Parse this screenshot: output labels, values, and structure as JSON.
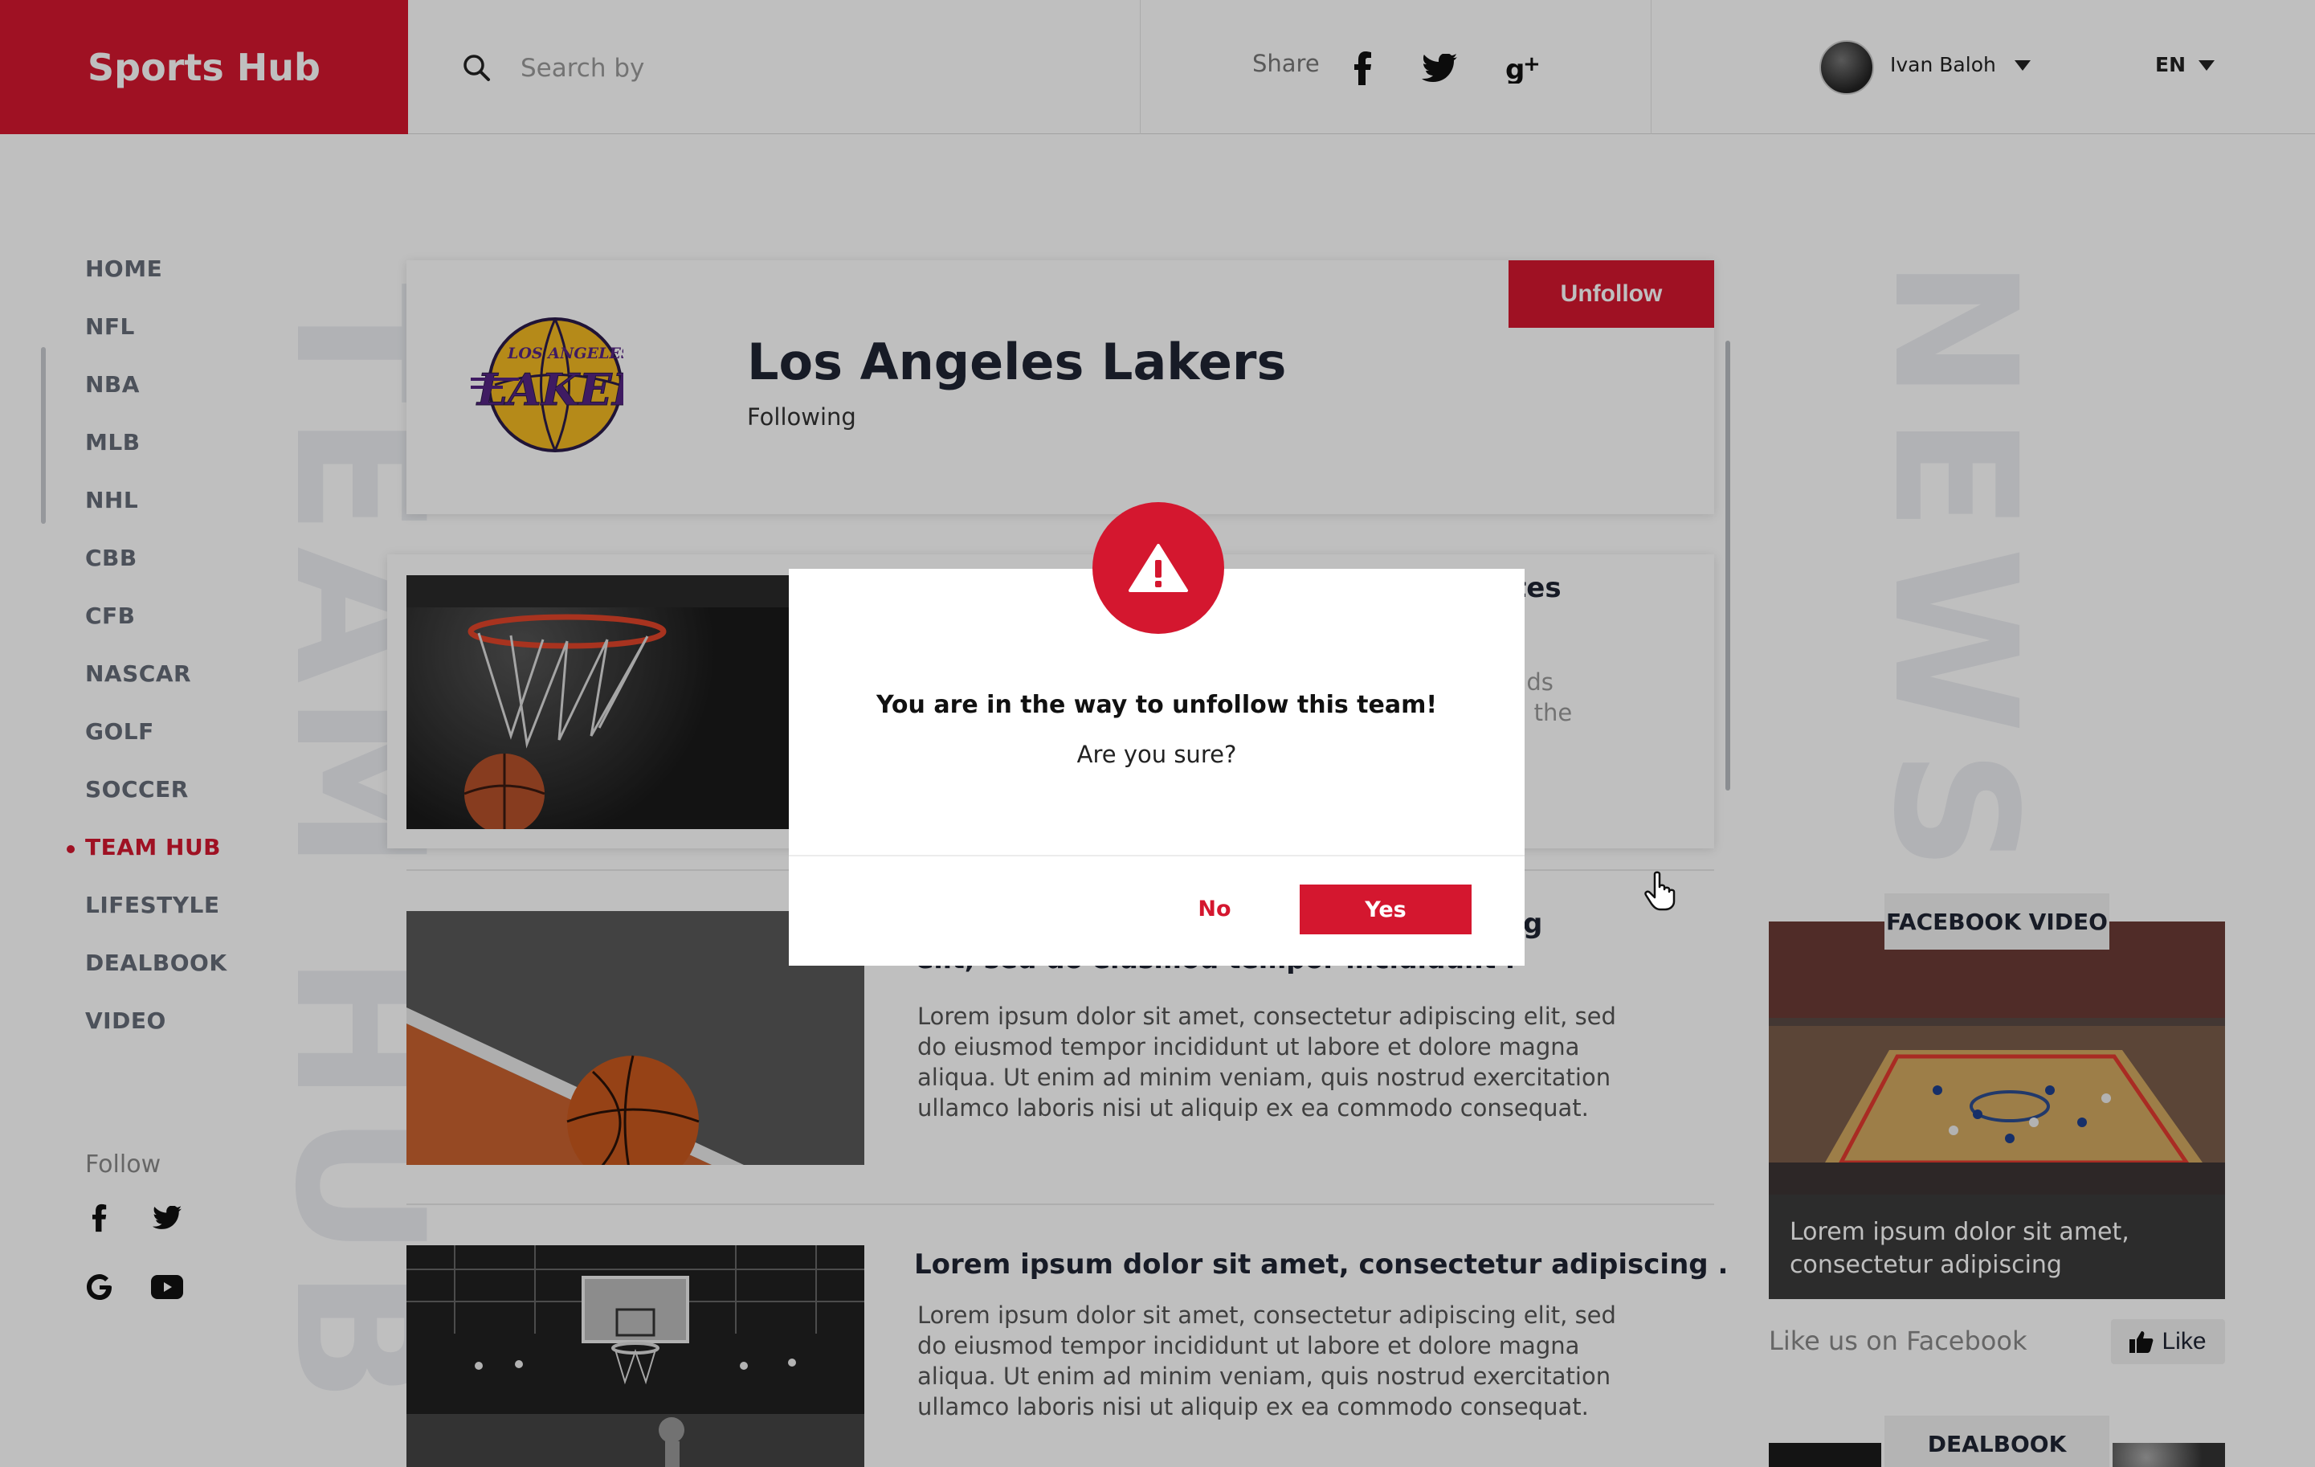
{
  "header": {
    "logo": "Sports Hub",
    "search_placeholder": "Search by",
    "share_label": "Share",
    "share_icons": [
      "facebook-icon",
      "twitter-icon",
      "google-plus-icon"
    ],
    "user_name": "Ivan Baloh",
    "language": "EN"
  },
  "nav": {
    "items": [
      "HOME",
      "NFL",
      "NBA",
      "MLB",
      "NHL",
      "CBB",
      "CFB",
      "NASCAR",
      "GOLF",
      "SOCCER",
      "TEAM HUB",
      "LIFESTYLE",
      "DEALBOOK",
      "VIDEO"
    ],
    "active": "TEAM HUB",
    "follow_label": "Follow",
    "follow_icons": [
      "facebook-icon",
      "twitter-icon",
      "google-icon",
      "youtube-icon"
    ]
  },
  "section_titles": {
    "team_hub": "TEAM HUB",
    "news": "NEWS"
  },
  "team": {
    "logo_text_top": "LOS ANGELES",
    "logo_text_main": "LAKERS",
    "name": "Los Angeles Lakers",
    "status": "Following",
    "unfollow_label": "Unfollow"
  },
  "articles": [
    {
      "title_visible": "tes",
      "body_visible": [
        "nds",
        "n the"
      ]
    },
    {
      "title_visible": "cing",
      "title_line2": "elit, sed do eiusmod tempor incididunt .",
      "body": "Lorem ipsum dolor sit amet, consectetur adipiscing elit, sed do eiusmod tempor incididunt ut labore et dolore magna aliqua. Ut enim ad minim veniam, quis nostrud exercitation ullamco laboris nisi ut aliquip ex ea commodo consequat."
    },
    {
      "title": "Lorem ipsum dolor sit amet, consectetur adipiscing .",
      "body": "Lorem ipsum dolor sit amet, consectetur adipiscing elit, sed do eiusmod tempor incididunt ut labore et dolore magna aliqua. Ut enim ad minim veniam, quis nostrud exercitation ullamco laboris nisi ut aliquip ex ea commodo consequat."
    }
  ],
  "sidebar": {
    "facebook_video_label": "FACEBOOK  VIDEO",
    "facebook_caption": "Lorem ipsum dolor sit amet, consectetur adipiscing",
    "like_us": "Like us on Facebook",
    "like_button": "Like",
    "dealbook_label": "DEALBOOK"
  },
  "modal": {
    "icon": "warning-icon",
    "title": "You are in the way to unfollow this team!",
    "subtitle": "Are you sure?",
    "no_label": "No",
    "yes_label": "Yes"
  },
  "colors": {
    "accent": "#d4172f",
    "text_dark": "#1f2433",
    "nav_text": "#666c78"
  }
}
